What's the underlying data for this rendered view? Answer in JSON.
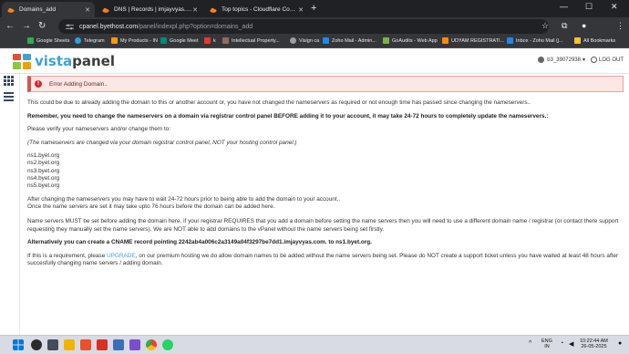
{
  "browser": {
    "tabs": [
      {
        "title": "Domains_add",
        "active": true
      },
      {
        "title": "DNS | Records | imjayvyas.com",
        "active": false
      },
      {
        "title": "Top topics - Cloudflare Commu",
        "active": false
      }
    ],
    "new_tab": "+",
    "window_controls": {
      "minimize": "—",
      "maximize": "☐",
      "close": "✕"
    },
    "url_domain": "cpanel.byethost.com",
    "url_path": "/panel/indexpl.php?option=domains_add",
    "bookmarks": [
      {
        "label": "Google Sheets",
        "color": "#34a853"
      },
      {
        "label": "Telegram",
        "color": "#2aa3df"
      },
      {
        "label": "My Products - IN",
        "color": "#ff9900"
      },
      {
        "label": "Google Meet",
        "color": "#00897b"
      },
      {
        "label": "k",
        "color": "#e53935"
      },
      {
        "label": "Intellectual Property...",
        "color": "#8d6e63"
      },
      {
        "label": "Visign ca",
        "color": "#9e9e9e"
      },
      {
        "label": "Zoho Mail - Admin...",
        "color": "#1e88e5"
      },
      {
        "label": "GoAudits - Web App",
        "color": "#7cb342"
      },
      {
        "label": "UDYAM REGISTRATI...",
        "color": "#fb8c00"
      },
      {
        "label": "Inbox - Zoho Mail (j...",
        "color": "#1e88e5"
      },
      {
        "label": "All Bookmarks",
        "color": "#fbc02d"
      }
    ]
  },
  "panel": {
    "logo_v": "vista",
    "logo_p": "panel",
    "username": "b3_39072938",
    "logout_label": "LOG OUT"
  },
  "alert": {
    "text": "Error Adding Domain.."
  },
  "message": {
    "p1": "This could be due to already adding the domain to this or another account or, you have not changed the nameservers as required or not enough time has passed since changing the nameservers..",
    "p2": "Remember, you need to change the nameservers on a domain via registrar control panel BEFORE adding it to your account, it may take 24-72 hours to completely update the nameservers.:",
    "p3": "Please verify your nameservers and/or change them to:",
    "p4": "(The nameservers are changed via your domain registrar control panel, NOT your hosting control panel.)",
    "nameservers": [
      "ns1.byet.org",
      "ns2.byet.org",
      "ns3.byet.org",
      "ns4.byet.org",
      "ns5.byet.org"
    ],
    "p5a": "After changing the nameservers you may have to wait 24-72 hours prior to being able to add the domain to your account..",
    "p5b": "Once the name servers are set it may take upto 76 hours before the domain can be added here.",
    "p6": "Name servers MUST be set before adding the domain here, if your registrar REQUIRES that you add a domain before setting the name servers then you will need to use a different domain name / registrar (or contact there support requesting they manually set the name servers). We are NOT able to add domains to the vPanel without the name servers being set firstly.",
    "p7": "Alternatively you can create a CNAME record pointing 2242ab4a006c2a3149a04f3297be7dd1.imjayvyas.com. to ns1.byet.org.",
    "p8_before": "If this is a requirement, please ",
    "p8_link": "UPGRADE",
    "p8_after": ", on our premium hosting we do allow domain names to be added without the name servers being set. Please do NOT create a support ticket unless you have waited at least 48 hours after succesfully changing name servers / adding domain."
  },
  "taskbar": {
    "lang_1": "ENG",
    "lang_2": "IN",
    "time": "10:22:44 AM",
    "date": "26-05-2025"
  }
}
